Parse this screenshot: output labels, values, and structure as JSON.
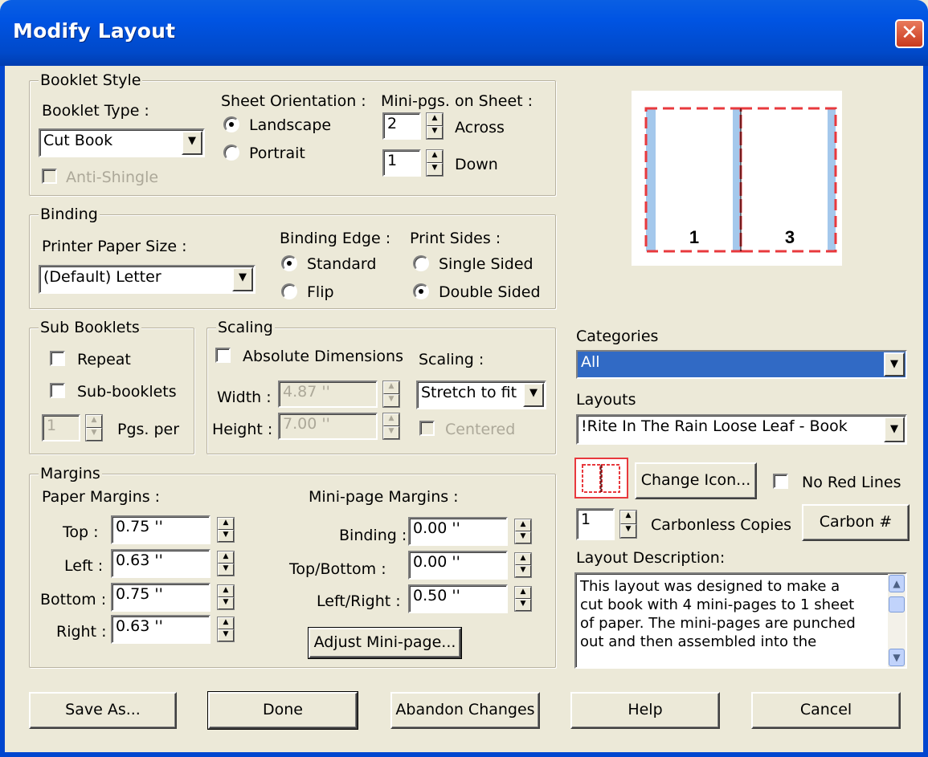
{
  "window": {
    "title": "Modify Layout",
    "close_glyph": "✕"
  },
  "booklet_style": {
    "legend": "Booklet Style",
    "booklet_type_label": "Booklet Type :",
    "booklet_type_value": "Cut Book",
    "anti_shingle_label": "Anti-Shingle",
    "sheet_orientation_label": "Sheet Orientation :",
    "landscape_label": "Landscape",
    "portrait_label": "Portrait",
    "orientation_selected": "Landscape",
    "minipgs_label": "Mini-pgs. on Sheet :",
    "across_value": "2",
    "across_label": "Across",
    "down_value": "1",
    "down_label": "Down"
  },
  "binding": {
    "legend": "Binding",
    "paper_size_label": "Printer Paper Size :",
    "paper_size_value": "(Default) Letter",
    "binding_edge_label": "Binding Edge :",
    "standard_label": "Standard",
    "flip_label": "Flip",
    "binding_edge_selected": "Standard",
    "print_sides_label": "Print Sides :",
    "single_label": "Single Sided",
    "double_label": "Double Sided",
    "print_sides_selected": "Double Sided"
  },
  "sub_booklets": {
    "legend": "Sub Booklets",
    "repeat_label": "Repeat",
    "sub_booklets_label": "Sub-booklets",
    "pgs_per_value": "1",
    "pgs_per_label": "Pgs. per"
  },
  "scaling": {
    "legend": "Scaling",
    "absolute_label": "Absolute Dimensions",
    "scaling_label": "Scaling :",
    "scaling_value": "Stretch to fit",
    "width_label": "Width :",
    "width_value": "4.87 ''",
    "height_label": "Height :",
    "height_value": "7.00 ''",
    "centered_label": "Centered"
  },
  "margins": {
    "legend": "Margins",
    "paper_margins_label": "Paper Margins :",
    "top_label": "Top :",
    "top_value": "0.75 ''",
    "left_label": "Left :",
    "left_value": "0.63 ''",
    "bottom_label": "Bottom :",
    "bottom_value": "0.75 ''",
    "right_label": "Right :",
    "right_value": "0.63 ''",
    "minipage_margins_label": "Mini-page Margins :",
    "binding_label": "Binding :",
    "binding_value": "0.00 ''",
    "topbottom_label": "Top/Bottom :",
    "topbottom_value": "0.00 ''",
    "leftright_label": "Left/Right :",
    "leftright_value": "0.50 ''",
    "adjust_button": "Adjust Mini-page..."
  },
  "preview": {
    "page_left": "1",
    "page_right": "3"
  },
  "right_panel": {
    "categories_label": "Categories",
    "categories_value": "All",
    "layouts_label": "Layouts",
    "layouts_value": "!Rite In The Rain Loose Leaf - Book",
    "change_icon_button": "Change Icon...",
    "no_red_lines_label": "No Red Lines",
    "carbonless_value": "1",
    "carbonless_label": "Carbonless Copies",
    "carbon_button": "Carbon #",
    "description_label": "Layout Description:",
    "description_text": "This layout was designed to make a\ncut  book with 4 mini-pages to 1 sheet\nof paper. The mini-pages are punched\nout and then assembled into the"
  },
  "buttons": {
    "save_as": "Save As...",
    "done": "Done",
    "abandon": "Abandon Changes",
    "help": "Help",
    "cancel": "Cancel"
  }
}
